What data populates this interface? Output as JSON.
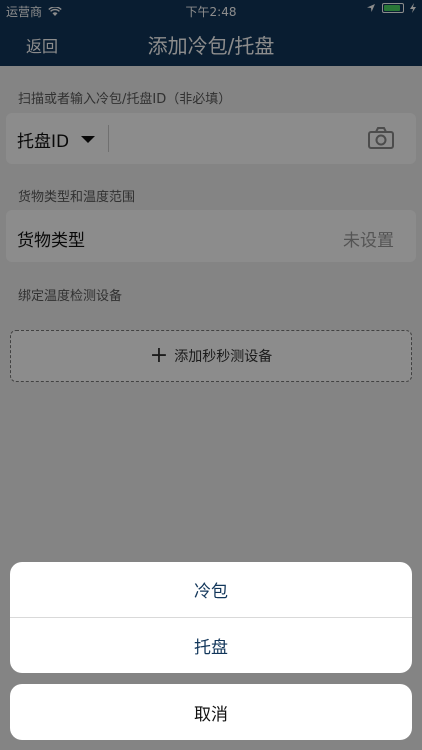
{
  "status_bar": {
    "carrier": "运营商",
    "time": "下午2:48",
    "battery_level": 0.9
  },
  "nav": {
    "back_label": "返回",
    "title": "添加冷包/托盘"
  },
  "scan_section": {
    "label": "扫描或者输入冷包/托盘ID（非必填）",
    "type_selector": "托盘ID",
    "icons": [
      "caret-down-icon",
      "camera-icon"
    ]
  },
  "cargo_section": {
    "label": "货物类型和温度范围",
    "field_label": "货物类型",
    "field_value": "未设置"
  },
  "device_section": {
    "label": "绑定温度检测设备",
    "add_button": "添加秒秒测设备"
  },
  "action_sheet": {
    "options": [
      "冷包",
      "托盘"
    ],
    "cancel": "取消"
  },
  "colors": {
    "nav_background": "#12365a",
    "accent_text": "#12365a",
    "battery": "#4cd964"
  }
}
